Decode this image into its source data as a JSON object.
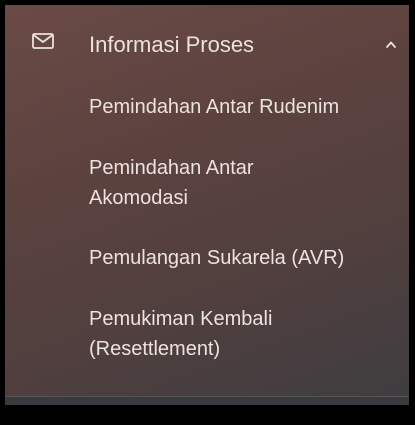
{
  "menu": {
    "header": {
      "icon": "mail-icon",
      "label": "Informasi Proses",
      "toggle_icon": "chevron-up-icon"
    },
    "items": [
      {
        "label": "Pemindahan Antar Rudenim"
      },
      {
        "label": "Pemindahan Antar Akomodasi"
      },
      {
        "label": "Pemulangan Sukarela (AVR)"
      },
      {
        "label": "Pemukiman Kembali (Resettlement)"
      }
    ]
  }
}
